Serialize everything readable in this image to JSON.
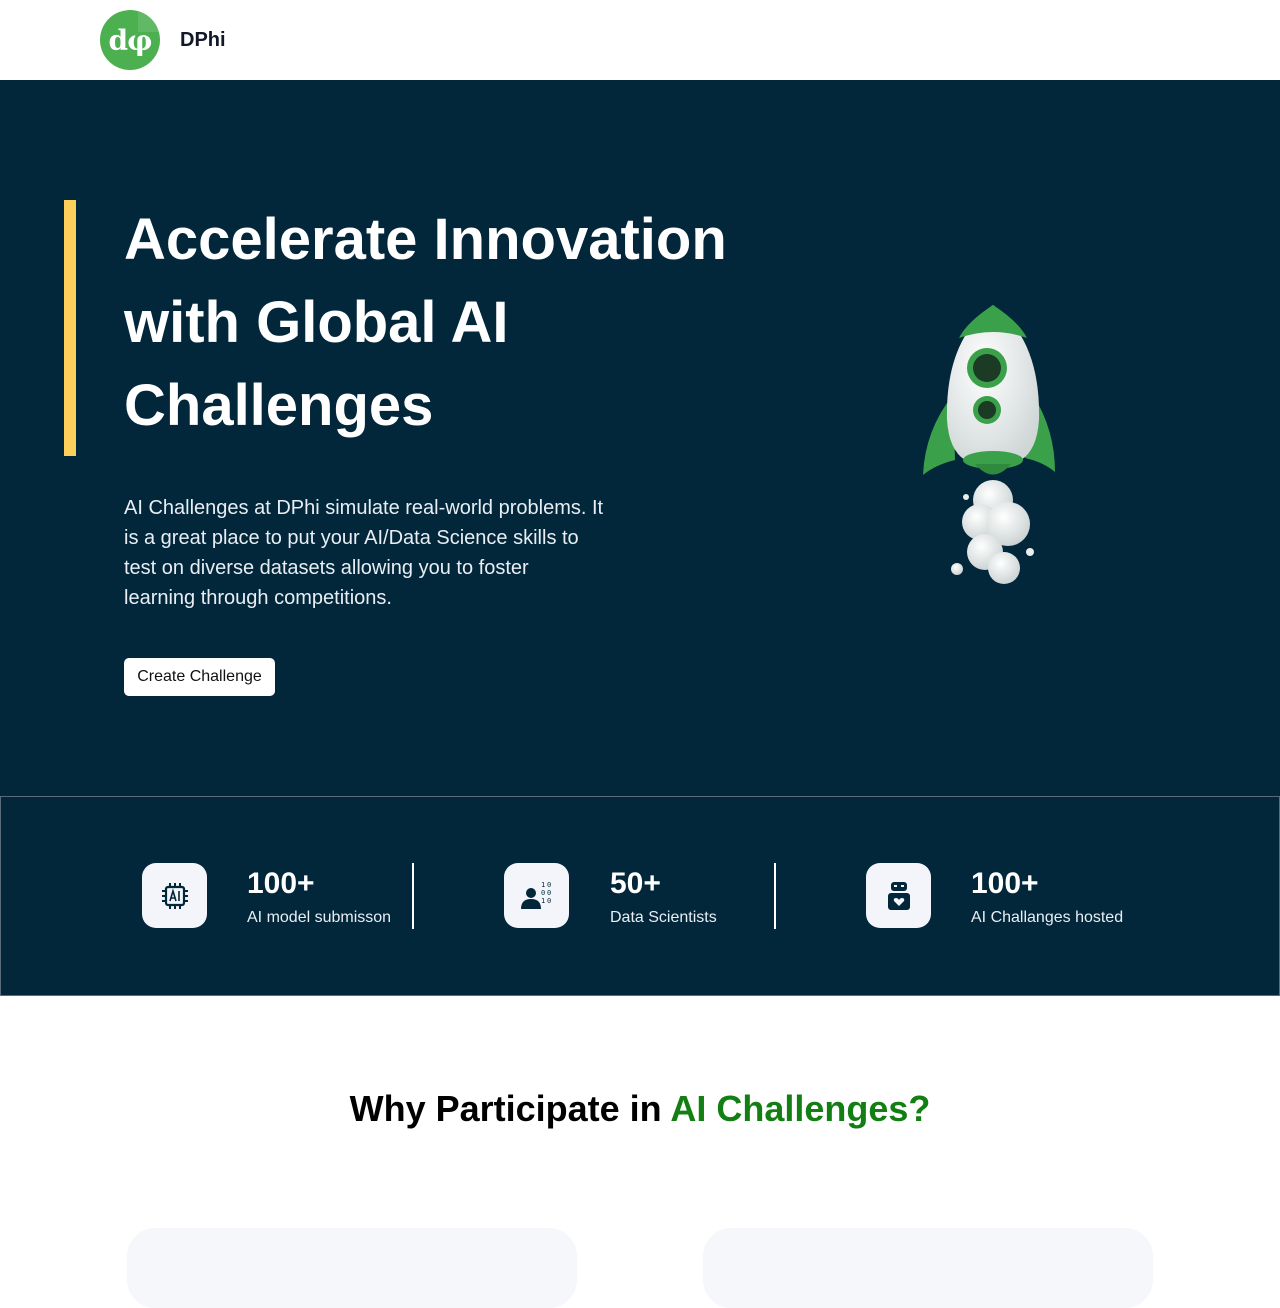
{
  "header": {
    "logo_text": "dφ",
    "brand": "DPhi"
  },
  "hero": {
    "title": "Accelerate Innovation with Global AI Challenges",
    "description": "AI Challenges at DPhi simulate real-world problems. It is a great place to put your AI/Data Science skills to test on diverse datasets allowing you to foster learning through competitions.",
    "cta_label": "Create Challenge",
    "accent_color": "#fcd05b",
    "background_color": "#02263a"
  },
  "stats": [
    {
      "icon": "ai-chip-icon",
      "value": "100+",
      "label": "AI model submisson"
    },
    {
      "icon": "data-scientist-icon",
      "value": "50+",
      "label": "Data Scientists"
    },
    {
      "icon": "robot-icon",
      "value": "100+",
      "label": "AI Challanges hosted"
    }
  ],
  "why": {
    "prefix": "Why Participate in ",
    "highlight": "AI Challenges?",
    "highlight_color": "#137f13"
  }
}
